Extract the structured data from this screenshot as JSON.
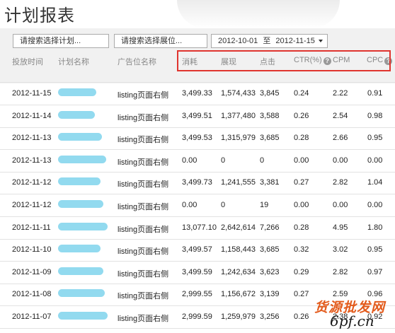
{
  "page_title": "计划报表",
  "filters": {
    "plan_placeholder": "请搜索选择计划...",
    "position_placeholder": "请搜索选择展位...",
    "date_start": "2012-10-01",
    "date_sep": "至",
    "date_end": "2012-11-15"
  },
  "columns": {
    "date": "投放时间",
    "plan": "计划名称",
    "position": "广告位名称",
    "cost": "消耗",
    "impressions": "展现",
    "clicks": "点击",
    "ctr": "CTR(%)",
    "cpm": "CPM",
    "cpc": "CPC"
  },
  "rows": [
    {
      "date": "2012-11-15",
      "plan": "",
      "position": "listing页面右侧",
      "cost": "3,499.33",
      "impressions": "1,574,433",
      "clicks": "3,845",
      "ctr": "0.24",
      "cpm": "2.22",
      "cpc": "0.91"
    },
    {
      "date": "2012-11-14",
      "plan": "",
      "position": "listing页面右侧",
      "cost": "3,499.51",
      "impressions": "1,377,480",
      "clicks": "3,588",
      "ctr": "0.26",
      "cpm": "2.54",
      "cpc": "0.98"
    },
    {
      "date": "2012-11-13",
      "plan": "",
      "position": "listing页面右侧",
      "cost": "3,499.53",
      "impressions": "1,315,979",
      "clicks": "3,685",
      "ctr": "0.28",
      "cpm": "2.66",
      "cpc": "0.95"
    },
    {
      "date": "2012-11-13",
      "plan": "",
      "position": "listing页面右侧",
      "cost": "0.00",
      "impressions": "0",
      "clicks": "0",
      "ctr": "0.00",
      "cpm": "0.00",
      "cpc": "0.00"
    },
    {
      "date": "2012-11-12",
      "plan": "",
      "position": "listing页面右侧",
      "cost": "3,499.73",
      "impressions": "1,241,555",
      "clicks": "3,381",
      "ctr": "0.27",
      "cpm": "2.82",
      "cpc": "1.04"
    },
    {
      "date": "2012-11-12",
      "plan": "",
      "position": "listing页面右侧",
      "cost": "0.00",
      "impressions": "0",
      "clicks": "19",
      "ctr": "0.00",
      "cpm": "0.00",
      "cpc": "0.00"
    },
    {
      "date": "2012-11-11",
      "plan": "",
      "position": "listing页面右侧",
      "cost": "13,077.10",
      "impressions": "2,642,614",
      "clicks": "7,266",
      "ctr": "0.28",
      "cpm": "4.95",
      "cpc": "1.80"
    },
    {
      "date": "2012-11-10",
      "plan": "",
      "position": "listing页面右侧",
      "cost": "3,499.57",
      "impressions": "1,158,443",
      "clicks": "3,685",
      "ctr": "0.32",
      "cpm": "3.02",
      "cpc": "0.95"
    },
    {
      "date": "2012-11-09",
      "plan": "",
      "position": "listing页面右侧",
      "cost": "3,499.59",
      "impressions": "1,242,634",
      "clicks": "3,623",
      "ctr": "0.29",
      "cpm": "2.82",
      "cpc": "0.97"
    },
    {
      "date": "2012-11-08",
      "plan": "",
      "position": "listing页面右侧",
      "cost": "2,999.55",
      "impressions": "1,156,672",
      "clicks": "3,139",
      "ctr": "0.27",
      "cpm": "2.59",
      "cpc": "0.96"
    },
    {
      "date": "2012-11-07",
      "plan": "",
      "position": "listing页面右侧",
      "cost": "2,999.59",
      "impressions": "1,259,979",
      "clicks": "3,256",
      "ctr": "0.26",
      "cpm": "2.38",
      "cpc": "0.92"
    }
  ],
  "watermark": {
    "cn_text": "货源批发网",
    "url_text": "6pf.cn"
  },
  "colors": {
    "highlight_border": "#e0352f",
    "redaction_blur": "#7fd4ec",
    "panel_bg": "#f1f1f1"
  }
}
